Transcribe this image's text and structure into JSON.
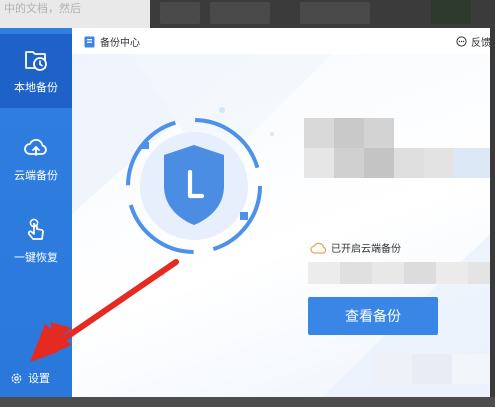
{
  "background": {
    "text": "中的文档，然后"
  },
  "sidebar": {
    "items": [
      {
        "label": "本地备份",
        "icon": "folder-clock-icon",
        "active": true
      },
      {
        "label": "云端备份",
        "icon": "cloud-upload-icon",
        "active": false
      },
      {
        "label": "一键恢复",
        "icon": "hand-tap-icon",
        "active": false
      }
    ],
    "settings_label": "设置",
    "settings_icon": "gear-icon"
  },
  "titlebar": {
    "title": "备份中心",
    "feedback_label": "反馈"
  },
  "main": {
    "shield_letter": "L",
    "cloud_status": "已开启云端备份",
    "view_button": "查看备份"
  },
  "colors": {
    "sidebar": "#2f7fe0",
    "sidebar_active": "#1f62c7",
    "accent": "#3a86e6",
    "annotation_arrow": "#e52a21",
    "cloud_icon": "#f0a35c"
  }
}
